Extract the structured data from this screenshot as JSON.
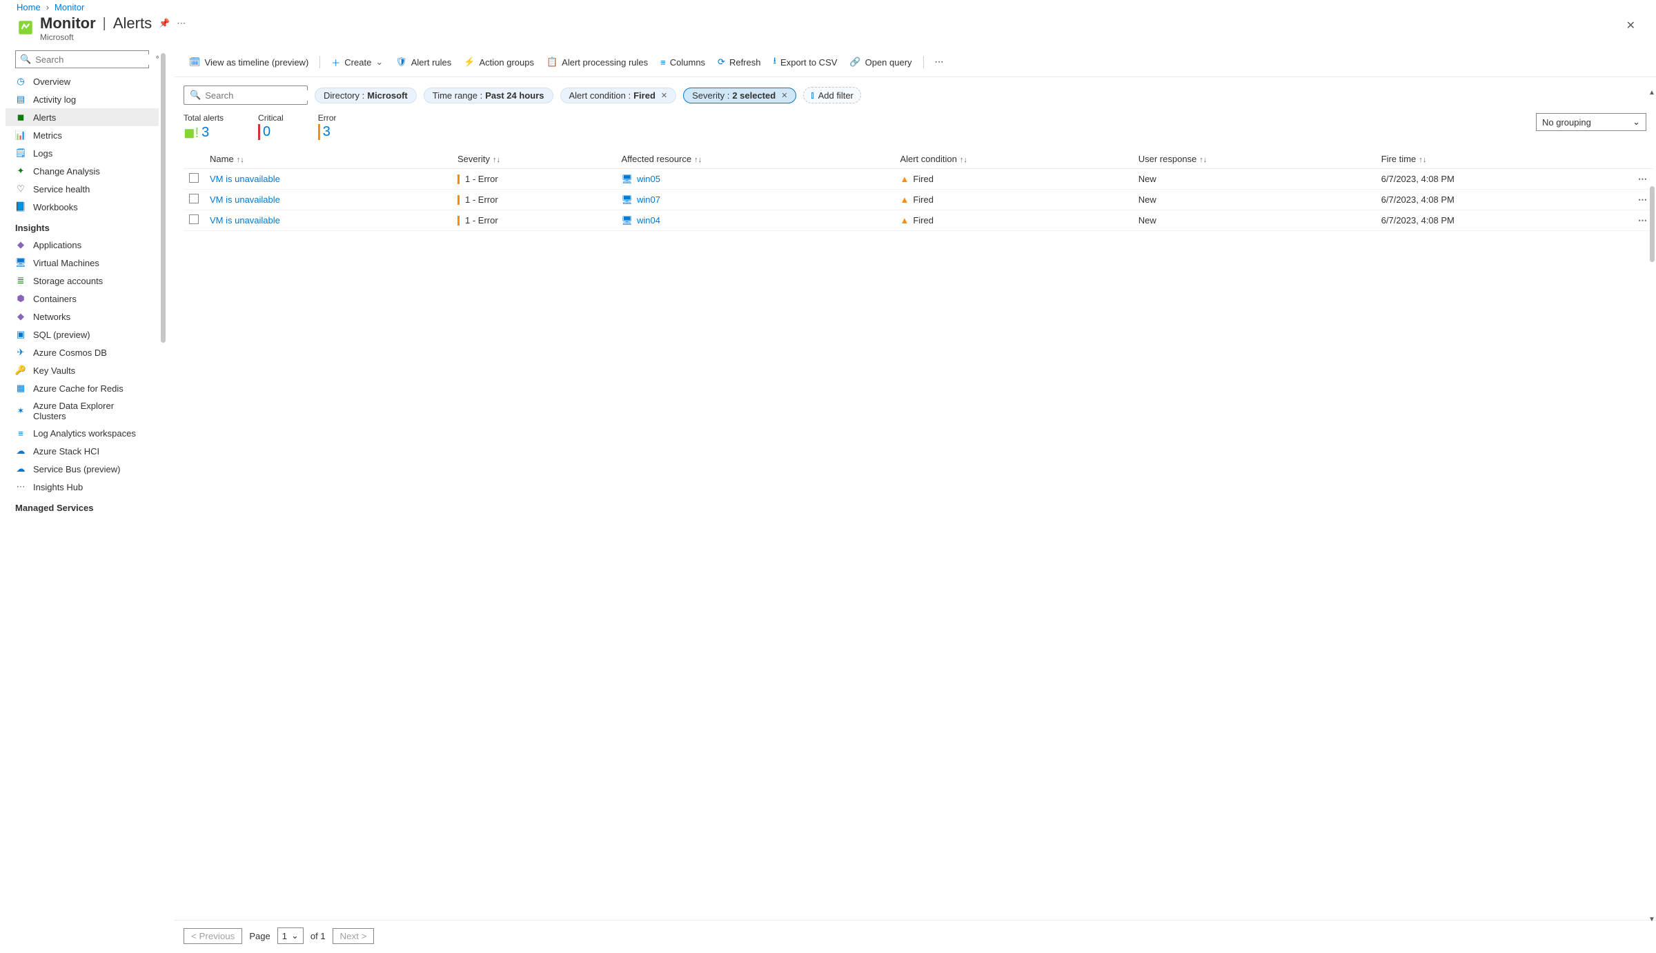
{
  "breadcrumb": {
    "home": "Home",
    "current": "Monitor"
  },
  "header": {
    "service": "Monitor",
    "page": "Alerts",
    "subtitle": "Microsoft"
  },
  "sidebar": {
    "search_placeholder": "Search",
    "top": [
      {
        "label": "Overview",
        "color": "#0078d4",
        "glyph": "◷"
      },
      {
        "label": "Activity log",
        "color": "#0078d4",
        "glyph": "▤"
      },
      {
        "label": "Alerts",
        "color": "#107c10",
        "glyph": "◼",
        "active": true
      },
      {
        "label": "Metrics",
        "color": "#0078d4",
        "glyph": "📊"
      },
      {
        "label": "Logs",
        "color": "#0078d4",
        "glyph": "🗒"
      },
      {
        "label": "Change Analysis",
        "color": "#107c10",
        "glyph": "✦"
      },
      {
        "label": "Service health",
        "color": "#323130",
        "glyph": "♡"
      },
      {
        "label": "Workbooks",
        "color": "#0078d4",
        "glyph": "📘"
      }
    ],
    "insights_header": "Insights",
    "insights": [
      {
        "label": "Applications",
        "color": "#8764b8",
        "glyph": "◆"
      },
      {
        "label": "Virtual Machines",
        "color": "#0078d4",
        "glyph": "🖥"
      },
      {
        "label": "Storage accounts",
        "color": "#107c10",
        "glyph": "≣"
      },
      {
        "label": "Containers",
        "color": "#8764b8",
        "glyph": "⬢"
      },
      {
        "label": "Networks",
        "color": "#8764b8",
        "glyph": "◆"
      },
      {
        "label": "SQL (preview)",
        "color": "#0078d4",
        "glyph": "▣"
      },
      {
        "label": "Azure Cosmos DB",
        "color": "#0078d4",
        "glyph": "✈"
      },
      {
        "label": "Key Vaults",
        "color": "#eaa300",
        "glyph": "🔑"
      },
      {
        "label": "Azure Cache for Redis",
        "color": "#0078d4",
        "glyph": "▦"
      },
      {
        "label": "Azure Data Explorer Clusters",
        "color": "#0078d4",
        "glyph": "✶"
      },
      {
        "label": "Log Analytics workspaces",
        "color": "#0078d4",
        "glyph": "≡"
      },
      {
        "label": "Azure Stack HCI",
        "color": "#0078d4",
        "glyph": "☁"
      },
      {
        "label": "Service Bus (preview)",
        "color": "#0078d4",
        "glyph": "☁"
      },
      {
        "label": "Insights Hub",
        "color": "#605e5c",
        "glyph": "⋯"
      }
    ],
    "managed_header": "Managed Services"
  },
  "toolbar": {
    "timeline": "View as timeline (preview)",
    "create": "Create",
    "alert_rules": "Alert rules",
    "action_groups": "Action groups",
    "processing_rules": "Alert processing rules",
    "columns": "Columns",
    "refresh": "Refresh",
    "export": "Export to CSV",
    "open_query": "Open query"
  },
  "filters": {
    "search_placeholder": "Search",
    "directory": {
      "label": "Directory : ",
      "value": "Microsoft"
    },
    "time_range": {
      "label": "Time range : ",
      "value": "Past 24 hours"
    },
    "condition": {
      "label": "Alert condition : ",
      "value": "Fired"
    },
    "severity": {
      "label": "Severity : ",
      "value": "2 selected"
    },
    "add": "Add filter"
  },
  "summary": {
    "total": {
      "label": "Total alerts",
      "value": "3"
    },
    "critical": {
      "label": "Critical",
      "value": "0"
    },
    "error": {
      "label": "Error",
      "value": "3"
    },
    "grouping": "No grouping"
  },
  "table": {
    "columns": {
      "name": "Name",
      "severity": "Severity",
      "resource": "Affected resource",
      "condition": "Alert condition",
      "response": "User response",
      "fire": "Fire time"
    },
    "rows": [
      {
        "name": "VM is unavailable",
        "severity": "1 - Error",
        "resource": "win05",
        "condition": "Fired",
        "response": "New",
        "fire": "6/7/2023, 4:08 PM"
      },
      {
        "name": "VM is unavailable",
        "severity": "1 - Error",
        "resource": "win07",
        "condition": "Fired",
        "response": "New",
        "fire": "6/7/2023, 4:08 PM"
      },
      {
        "name": "VM is unavailable",
        "severity": "1 - Error",
        "resource": "win04",
        "condition": "Fired",
        "response": "New",
        "fire": "6/7/2023, 4:08 PM"
      }
    ]
  },
  "pager": {
    "prev": "< Previous",
    "page_label": "Page",
    "page": "1",
    "of": "of 1",
    "next": "Next >"
  }
}
